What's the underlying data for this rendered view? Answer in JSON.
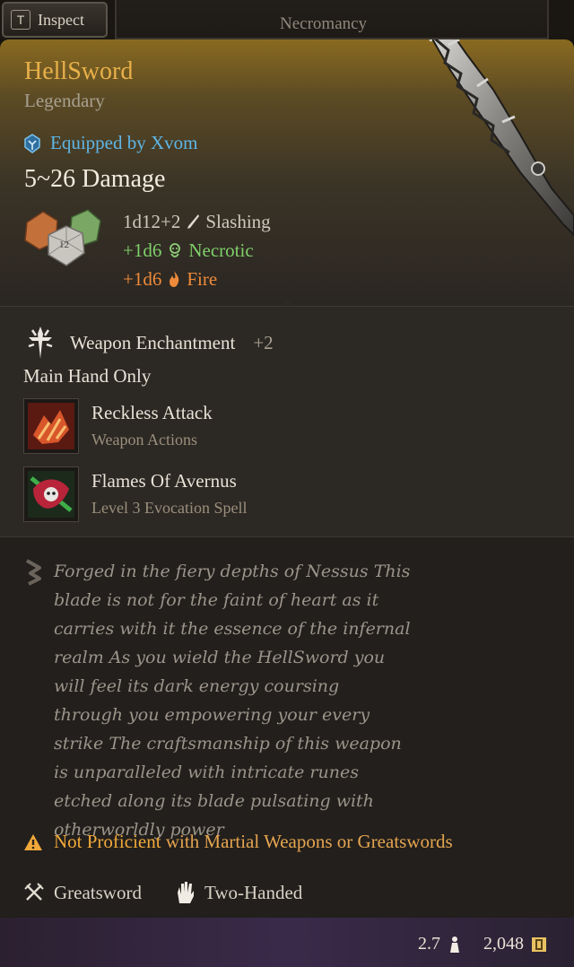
{
  "topbar": {
    "inspect_key": "T",
    "inspect_label": "Inspect",
    "tab_label": "Necromancy"
  },
  "item": {
    "name": "HellSword",
    "rarity": "Legendary",
    "equipped_by": "Equipped by Xvom",
    "damage": "5~26 Damage",
    "damage_lines": {
      "base": {
        "dice": "1d12+2",
        "type": "Slashing"
      },
      "necrotic": {
        "dice": "+1d6",
        "type": "Necrotic"
      },
      "fire": {
        "dice": "+1d6",
        "type": "Fire"
      }
    },
    "die_label": "12"
  },
  "enchantment": {
    "name": "Weapon Enchantment",
    "bonus": "+2",
    "main_hand": "Main Hand Only"
  },
  "actions": [
    {
      "name": "Reckless Attack",
      "sub": "Weapon Actions"
    },
    {
      "name": "Flames Of Avernus",
      "sub": "Level 3 Evocation Spell"
    }
  ],
  "description": "Forged in the fiery depths of Nessus This blade is not for the faint of heart as it carries with it the essence of the infernal realm As you wield the HellSword you will feel its dark energy coursing through you empowering your every strike The craftsmanship of this weapon is unparalleled with intricate runes etched along its blade pulsating with otherworldly power",
  "warning": {
    "part1": "Not Proficient",
    "part2": "with Martial Weapons or Greatswords"
  },
  "properties": {
    "weapon_type": "Greatsword",
    "handedness": "Two-Handed"
  },
  "footer": {
    "weight": "2.7",
    "value": "2,048"
  },
  "colors": {
    "title": "#e8b04a",
    "equipped": "#5fb6e6",
    "necrotic": "#7fcf6a",
    "fire": "#ee8a3a",
    "warning": "#f0a93a"
  }
}
